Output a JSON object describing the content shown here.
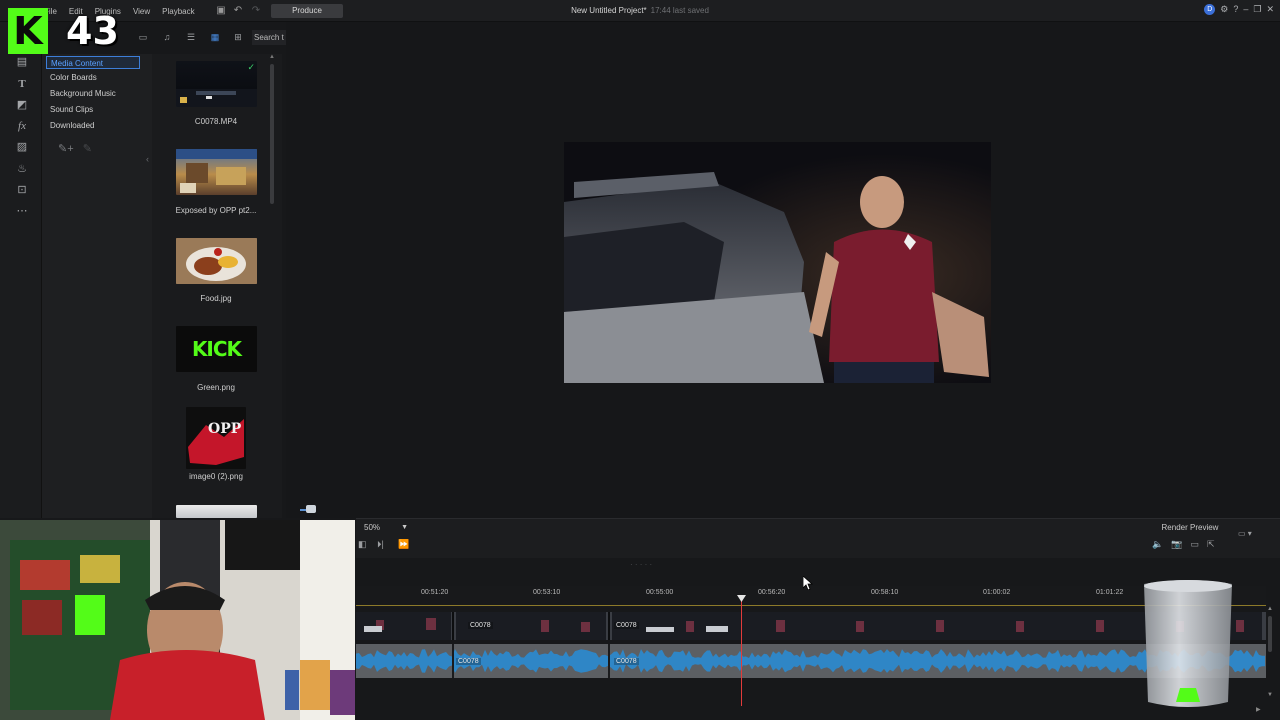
{
  "overlay": {
    "channel_number": "43",
    "kick_letter": "K"
  },
  "menu": {
    "file": "File",
    "edit": "Edit",
    "plugins": "Plugins",
    "view": "View",
    "playback": "Playback"
  },
  "produce_label": "Produce",
  "project": {
    "title": "New Untitled Project*",
    "saved_status": "17:44 last saved"
  },
  "library": {
    "search_placeholder": "Search t",
    "categories": [
      {
        "label": "Media Content",
        "selected": true
      },
      {
        "label": "Color Boards"
      },
      {
        "label": "Background Music"
      },
      {
        "label": "Sound Clips"
      },
      {
        "label": "Downloaded"
      }
    ],
    "items": [
      {
        "label": "C0078.MP4",
        "icon": "video-clip-thumbnail"
      },
      {
        "label": "Exposed by OPP pt2...",
        "icon": "image-thumbnail"
      },
      {
        "label": "Food.jpg",
        "icon": "food-thumbnail"
      },
      {
        "label": "Green.png",
        "icon": "kick-logo-thumbnail",
        "text": "KICK"
      },
      {
        "label": "image0 (2).png",
        "icon": "opp-graphic-thumbnail",
        "text": "OPP"
      }
    ]
  },
  "timeline": {
    "zoom": "50%",
    "render_preview": "Render Preview",
    "ruler_labels": [
      "00:51:20",
      "00:53:10",
      "00:55:00",
      "00:56:20",
      "00:58:10",
      "01:00:02",
      "01:01:22"
    ],
    "clip_name": "C0078"
  },
  "colors": {
    "accent": "#3d7ed9",
    "kick_green": "#53fc18",
    "playhead": "#e23b3b",
    "audio_track": "#2a4b68"
  }
}
